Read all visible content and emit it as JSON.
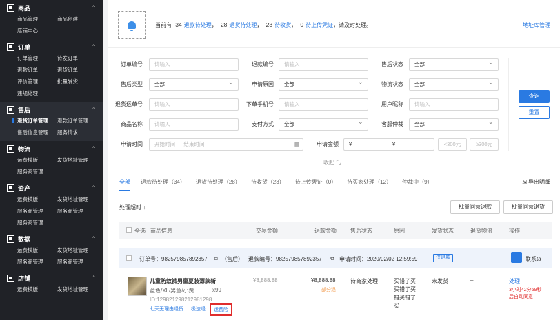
{
  "sidebar": {
    "sections": [
      {
        "title": "商品",
        "items": [
          "商品管理",
          "商品创建",
          "店铺中心"
        ]
      },
      {
        "title": "订单",
        "items": [
          "订单管理",
          "待发订单",
          "退款订单",
          "退货订单",
          "评价管理",
          "批量发货",
          "违规处理"
        ]
      },
      {
        "title": "售后",
        "items": [
          "退货订单管理",
          "退款订单管理",
          "售后信息管理",
          "服务请求"
        ]
      },
      {
        "title": "物流",
        "items": [
          "运费模版",
          "发货地址管理",
          "服务商管理"
        ]
      },
      {
        "title": "资产",
        "items": [
          "运费模版",
          "发货地址管理",
          "服务商管理",
          "服务商管理",
          "服务商管理"
        ]
      },
      {
        "title": "数据",
        "items": [
          "运费模版",
          "发货地址管理",
          "服务商管理",
          "服务商管理"
        ]
      },
      {
        "title": "店铺",
        "items": [
          "运费模版",
          "发货地址管理"
        ]
      }
    ]
  },
  "notice": {
    "prefix": "当前有",
    "c1": "34",
    "l1": "退款待处理",
    "c2": "28",
    "l2": "退货待处理",
    "c3": "23",
    "l3": "待收货",
    "c4": "0",
    "l4": "待上传凭证",
    "suffix": "，请及时处理。",
    "addr_link": "地址库管理"
  },
  "filters": {
    "order_no": {
      "label": "订单编号",
      "placeholder": "请输入"
    },
    "refund_no": {
      "label": "退款编号",
      "placeholder": "请输入"
    },
    "after_status": {
      "label": "售后状态",
      "value": "全部"
    },
    "after_type": {
      "label": "售后类型",
      "value": "全部"
    },
    "apply_reason": {
      "label": "申请原因",
      "value": "全部"
    },
    "logistics_status": {
      "label": "物流状态",
      "value": "全部"
    },
    "return_waybill": {
      "label": "退货运单号",
      "placeholder": "请输入"
    },
    "phone": {
      "label": "下单手机号",
      "placeholder": "请输入"
    },
    "nickname": {
      "label": "用户昵称",
      "placeholder": "请输入"
    },
    "product_name": {
      "label": "商品名称",
      "placeholder": "请输入"
    },
    "pay_method": {
      "label": "支付方式",
      "value": "全部"
    },
    "arbitration": {
      "label": "客服仲裁",
      "value": "全部"
    },
    "apply_time": {
      "label": "申请时间",
      "start": "开始时间",
      "dash": "–",
      "end": "结束时间"
    },
    "amount": {
      "label": "申请金额",
      "cur1": "¥",
      "dash": "–",
      "cur2": "¥",
      "lt": "<300元",
      "gt": "≥300元"
    },
    "query": "查询",
    "reset": "重置",
    "collapse": "收起"
  },
  "tabs": [
    "全部",
    "退款待处理（34）",
    "退货待处理（28）",
    "待收货（23）",
    "待上传凭证（0）",
    "待买家处理（12）",
    "仲裁中（9）"
  ],
  "export": "导出明细",
  "sort": "处理超时 ↓",
  "batch_refund": "批量同意退款",
  "batch_return": "批量同意退货",
  "table_head": {
    "select_all": "全选",
    "product": "商品信息",
    "trade": "交易金额",
    "refund": "退款金额",
    "after": "售后状态",
    "reason": "原因",
    "ship": "发货状态",
    "return_logistics": "退货物流",
    "op": "操作"
  },
  "order": {
    "order_no": "订单号：982579857892357",
    "aftersale_tag": "（售后）",
    "refund_no": "退款编号：982579857892357",
    "apply_time": "申请时间：2020/02/02  12:59:59",
    "status_tag": "仅退款",
    "contact": "联系ta"
  },
  "row": {
    "title": "儿童防蚊裤男童夏装薄款新",
    "spec": "蓝色/XL/男童/小黄...",
    "qty": "x99",
    "id": "ID:129821298212981298",
    "tag1": "七天无理由退货",
    "tag2": "极速退",
    "tag3": "运费险",
    "trade": "¥8,888.88",
    "refund": "¥8,888.88",
    "refund_note": "部分退",
    "after": "待商家处理",
    "reason1": "买错了买",
    "reason2": "买错了买",
    "reason3": "错买错了",
    "reason4": "买",
    "ship": "未发货",
    "logistics": "–",
    "op": "处理",
    "timeout1": "3小时42分59秒",
    "timeout2": "后自动同意"
  }
}
